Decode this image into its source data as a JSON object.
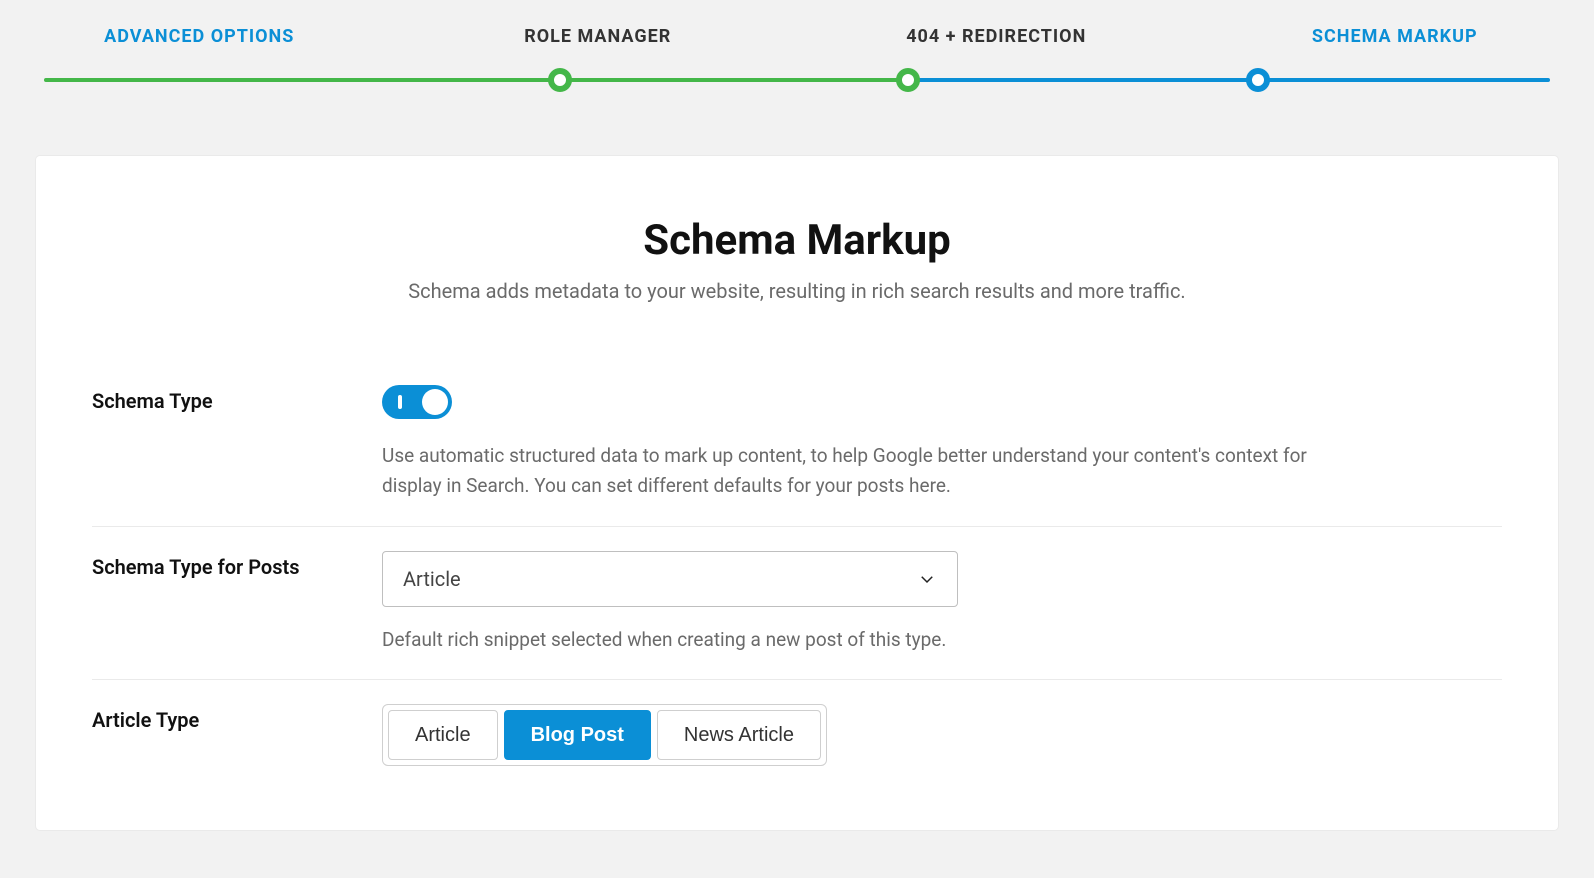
{
  "stepper": {
    "steps": [
      {
        "label": "ADVANCED OPTIONS",
        "state": "active"
      },
      {
        "label": "ROLE MANAGER",
        "state": "done"
      },
      {
        "label": "404 + REDIRECTION",
        "state": "done"
      },
      {
        "label": "SCHEMA MARKUP",
        "state": "current"
      }
    ]
  },
  "page": {
    "title": "Schema Markup",
    "subtitle": "Schema adds metadata to your website, resulting in rich search results and more traffic."
  },
  "schema_type": {
    "label": "Schema Type",
    "enabled": true,
    "desc": "Use automatic structured data to mark up content, to help Google better understand your content's context for display in Search. You can set different defaults for your posts here."
  },
  "schema_type_posts": {
    "label": "Schema Type for Posts",
    "value": "Article",
    "desc": "Default rich snippet selected when creating a new post of this type."
  },
  "article_type": {
    "label": "Article Type",
    "options": [
      "Article",
      "Blog Post",
      "News Article"
    ],
    "selected": "Blog Post"
  },
  "colors": {
    "accent": "#0b8fd6",
    "success": "#44b749"
  }
}
